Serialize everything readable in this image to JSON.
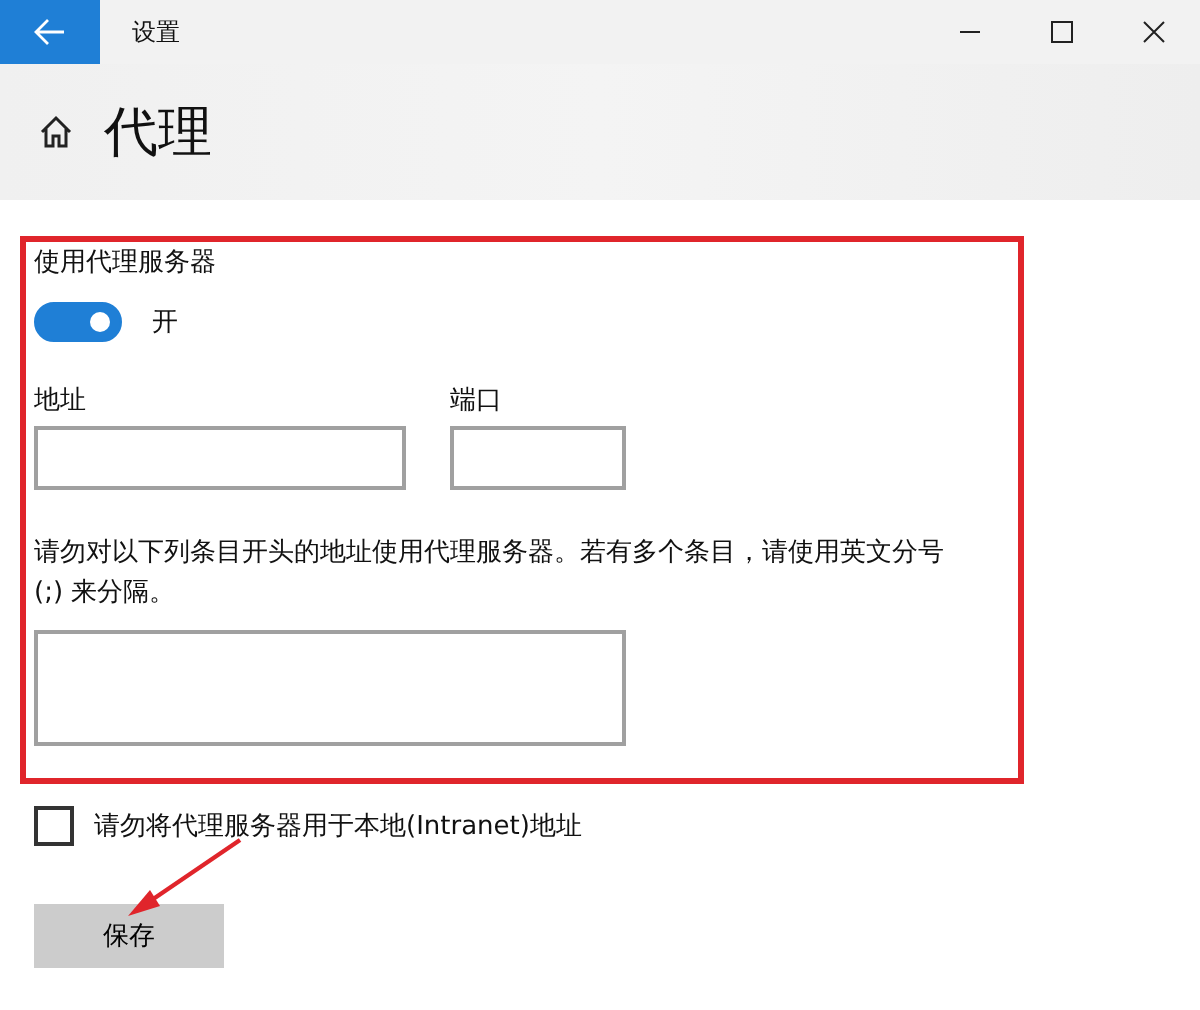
{
  "window": {
    "title": "设置"
  },
  "page_title": "代理",
  "manual_proxy": {
    "label": "使用代理服务器",
    "on": true,
    "state_label": "开",
    "address": {
      "label": "地址"
    },
    "port": {
      "label": "端口"
    },
    "exceptions": {
      "description": "请勿对以下列条目开头的地址使用代理服务器。若有多个条目，请使用英文分号 (;) 来分隔。"
    },
    "bypass_local": {
      "label": "请勿将代理服务器用于本地(Intranet)地址",
      "checked": false
    },
    "save_button": "保存"
  }
}
